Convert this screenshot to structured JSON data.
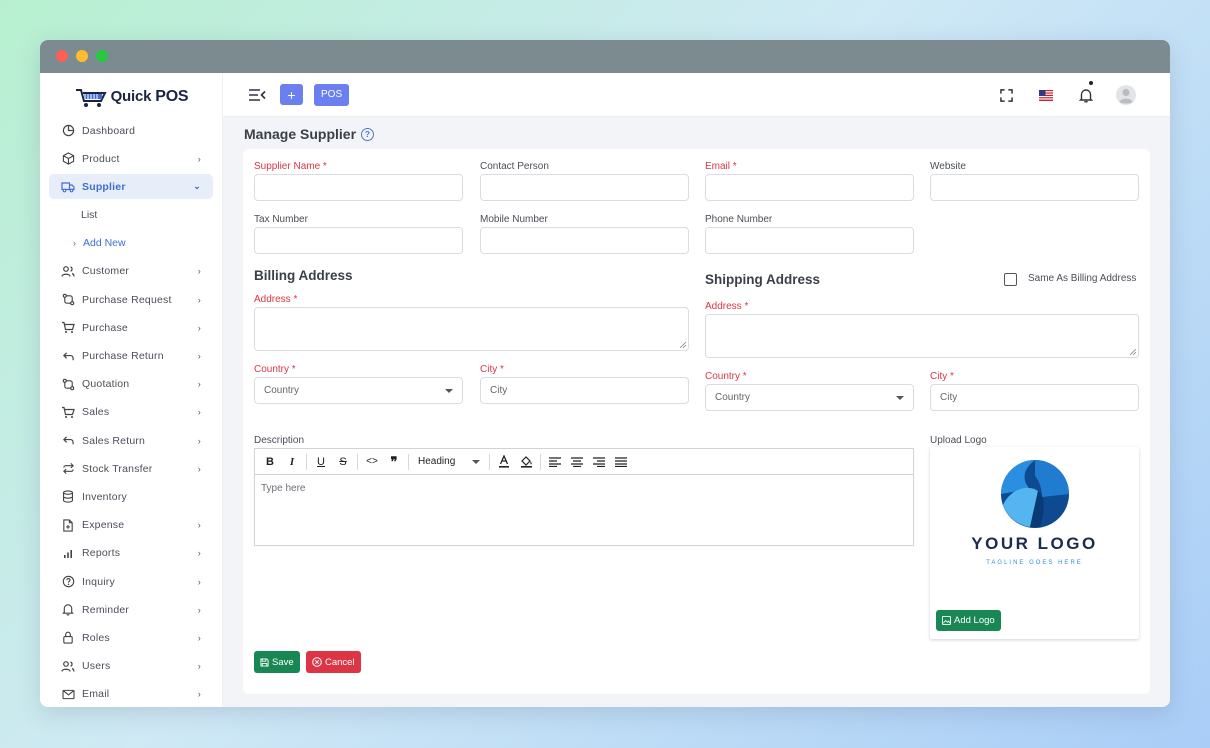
{
  "app": {
    "brand_quick": "Quick",
    "brand_pos": "POS"
  },
  "topbar": {
    "plus_label": "+",
    "pos_label": "POS"
  },
  "sidebar": {
    "items": [
      {
        "label": "Dashboard",
        "icon": "dashboard-icon",
        "chevron": false
      },
      {
        "label": "Product",
        "icon": "box-icon",
        "chevron": true
      },
      {
        "label": "Supplier",
        "icon": "truck-icon",
        "chevron": true,
        "active": true
      },
      {
        "label": "Customer",
        "icon": "users-icon",
        "chevron": true
      },
      {
        "label": "Purchase Request",
        "icon": "git-compare-icon",
        "chevron": true
      },
      {
        "label": "Purchase",
        "icon": "cart-icon",
        "chevron": true
      },
      {
        "label": "Purchase Return",
        "icon": "return-arrow-icon",
        "chevron": true
      },
      {
        "label": "Quotation",
        "icon": "git-compare-icon",
        "chevron": true
      },
      {
        "label": "Sales",
        "icon": "cart-icon",
        "chevron": true
      },
      {
        "label": "Sales Return",
        "icon": "return-arrow-icon",
        "chevron": true
      },
      {
        "label": "Stock Transfer",
        "icon": "transfer-icon",
        "chevron": true
      },
      {
        "label": "Inventory",
        "icon": "database-icon",
        "chevron": false
      },
      {
        "label": "Expense",
        "icon": "file-plus-icon",
        "chevron": true
      },
      {
        "label": "Reports",
        "icon": "bar-chart-icon",
        "chevron": true
      },
      {
        "label": "Inquiry",
        "icon": "question-circle-icon",
        "chevron": true
      },
      {
        "label": "Reminder",
        "icon": "bell-icon",
        "chevron": true
      },
      {
        "label": "Roles",
        "icon": "lock-icon",
        "chevron": true
      },
      {
        "label": "Users",
        "icon": "users-icon",
        "chevron": true
      },
      {
        "label": "Email",
        "icon": "mail-icon",
        "chevron": true
      }
    ],
    "supplier_sub": {
      "list": "List",
      "add_new": "Add New"
    }
  },
  "page": {
    "title": "Manage Supplier"
  },
  "form": {
    "supplier_name": "Supplier Name *",
    "contact_person": "Contact Person",
    "email": "Email *",
    "website": "Website",
    "tax_number": "Tax Number",
    "mobile_number": "Mobile Number",
    "phone_number": "Phone Number",
    "billing_title": "Billing Address",
    "shipping_title": "Shipping Address",
    "same_as_billing": "Same As Billing Address",
    "address": "Address *",
    "country": "Country *",
    "city": "City *",
    "country_placeholder": "Country",
    "city_placeholder": "City",
    "description": "Description",
    "upload_logo": "Upload Logo",
    "editor_placeholder": "Type here",
    "heading_select": "Heading",
    "logo_text": "YOUR LOGO",
    "logo_tagline": "TAGLINE GOES HERE",
    "add_logo": "Add Logo",
    "save": "Save",
    "cancel": "Cancel"
  },
  "colors": {
    "primary": "#6c7ff0",
    "active": "#3d6ed6",
    "required": "#dc3545",
    "success": "#198754"
  }
}
